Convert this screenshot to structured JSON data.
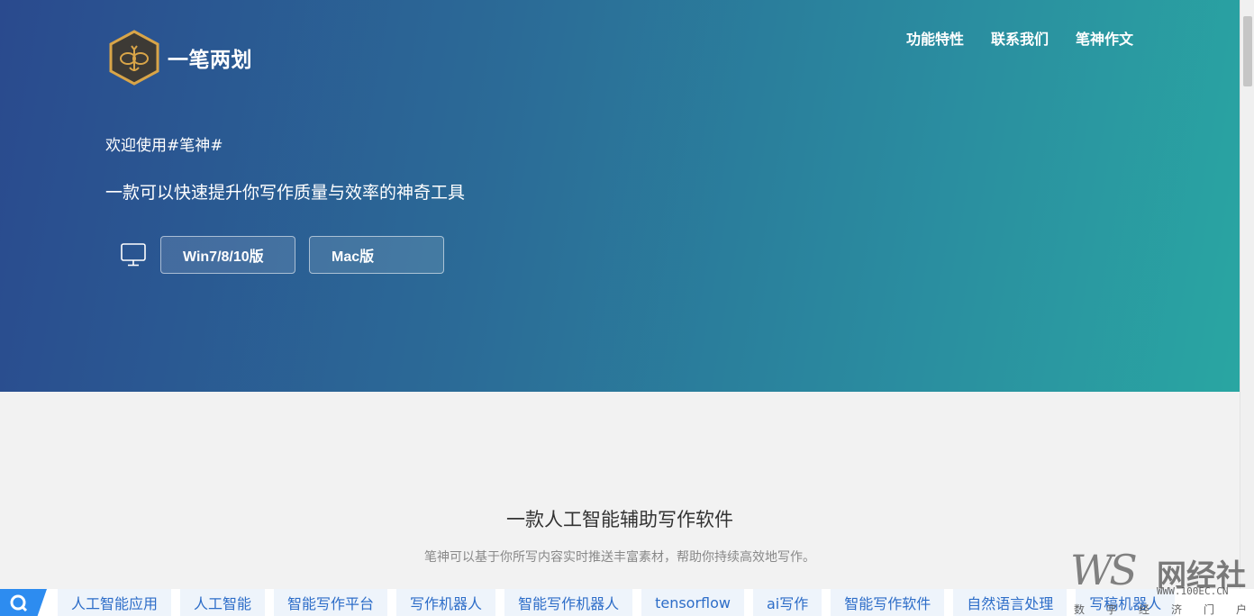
{
  "brand": {
    "name": "一笔两划"
  },
  "nav": {
    "items": [
      "功能特性",
      "联系我们",
      "笔神作文"
    ]
  },
  "hero": {
    "welcome": "欢迎使用#笔神#",
    "tagline": "一款可以快速提升你写作质量与效率的神奇工具",
    "downloads": [
      "Win7/8/10版",
      "Mac版"
    ]
  },
  "section": {
    "title": "一款人工智能辅助写作软件",
    "subtitle": "笔神可以基于你所写内容实时推送丰富素材，帮助你持续高效地写作。"
  },
  "tagbar": {
    "tags": [
      "人工智能应用",
      "人工智能",
      "智能写作平台",
      "写作机器人",
      "智能写作机器人",
      "tensorflow",
      "ai写作",
      "智能写作软件",
      "自然语言处理",
      "写稿机器人"
    ]
  },
  "watermark": {
    "logo": "WS",
    "cn": "网经社",
    "url": "WWW.100EC.CN",
    "sub": "数字经济门户"
  },
  "colors": {
    "hero_start": "#2a4a8e",
    "hero_end": "#29a6a2",
    "tag_text": "#2d6dc8",
    "search_bg": "#2d8cf0"
  }
}
